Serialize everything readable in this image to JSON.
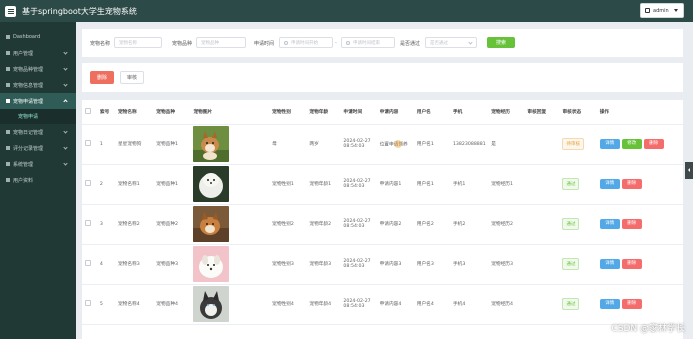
{
  "header": {
    "title": "基于springboot大学生宠物系统",
    "user": "admin"
  },
  "sidebar": {
    "items": [
      {
        "label": "Dashboard"
      },
      {
        "label": "用户管理"
      },
      {
        "label": "宠物品种管理"
      },
      {
        "label": "宠物信息管理"
      },
      {
        "label": "宠物申请管理"
      },
      {
        "label": "宠物日记管理"
      },
      {
        "label": "评分记录管理"
      },
      {
        "label": "系统管理"
      },
      {
        "label": "用户资料"
      }
    ],
    "sub_item": "宠物申请"
  },
  "search": {
    "pet_name_label": "宠物名称",
    "pet_name_placeholder": "宠物名称",
    "pet_breed_label": "宠物品种",
    "pet_breed_placeholder": "宠物品种",
    "apply_time_label": "申请时间",
    "start_placeholder": "申请时间开始",
    "end_placeholder": "申请时间结束",
    "passed_label": "是否通过",
    "passed_placeholder": "是否通过",
    "search_button": "搜索"
  },
  "actions": {
    "delete": "删除",
    "audit": "审核"
  },
  "table": {
    "headers": [
      "索号",
      "宠物名称",
      "宠物品种",
      "宠物图片",
      "宠物性别",
      "宠物年龄",
      "申请时间",
      "申请内容",
      "用户名",
      "手机",
      "宠物经历",
      "审核回复",
      "审核状态",
      "操作"
    ],
    "rows": [
      {
        "index": "1",
        "name": "星星宠物狗",
        "breed": "宠物品种1",
        "gender": "母",
        "age": "两岁",
        "time": "2024-02-27 08:54:03",
        "content": "位置申请领养",
        "user": "用户名1",
        "phone": "13823088881",
        "exp": "是",
        "reply": "",
        "status": "待审核",
        "status_type": "wait",
        "ops": [
          "详情",
          "修改",
          "删除"
        ]
      },
      {
        "index": "2",
        "name": "宠物名称1",
        "breed": "宠物品种1",
        "gender": "宠物性别1",
        "age": "宠物年龄1",
        "time": "2024-02-27 08:54:03",
        "content": "申请内容1",
        "user": "用户名1",
        "phone": "手机1",
        "exp": "宠物经历1",
        "reply": "",
        "status": "通过",
        "status_type": "pass",
        "ops": [
          "详情",
          "删除"
        ]
      },
      {
        "index": "3",
        "name": "宠物名称2",
        "breed": "宠物品种2",
        "gender": "宠物性别2",
        "age": "宠物年龄2",
        "time": "2024-02-27 08:54:03",
        "content": "申请内容2",
        "user": "用户名2",
        "phone": "手机2",
        "exp": "宠物经历2",
        "reply": "",
        "status": "通过",
        "status_type": "pass",
        "ops": [
          "详情",
          "删除"
        ]
      },
      {
        "index": "4",
        "name": "宠物名称3",
        "breed": "宠物品种3",
        "gender": "宠物性别3",
        "age": "宠物年龄3",
        "time": "2024-02-27 08:54:03",
        "content": "申请内容3",
        "user": "用户名3",
        "phone": "手机3",
        "exp": "宠物经历3",
        "reply": "",
        "status": "通过",
        "status_type": "pass",
        "ops": [
          "详情",
          "删除"
        ]
      },
      {
        "index": "5",
        "name": "宠物名称4",
        "breed": "宠物品种4",
        "gender": "宠物性别4",
        "age": "宠物年龄4",
        "time": "2024-02-27 08:54:03",
        "content": "申请内容4",
        "user": "用户名4",
        "phone": "手机4",
        "exp": "宠物经历4",
        "reply": "",
        "status": "通过",
        "status_type": "pass",
        "ops": [
          "详情",
          "删除"
        ]
      }
    ]
  },
  "watermark": "CSDN @家林学长",
  "colors": {
    "header": "#2c4a47",
    "sidebar": "#203935",
    "primary_green": "#67c23a",
    "danger": "#f56c6c",
    "info": "#53a8e8"
  }
}
